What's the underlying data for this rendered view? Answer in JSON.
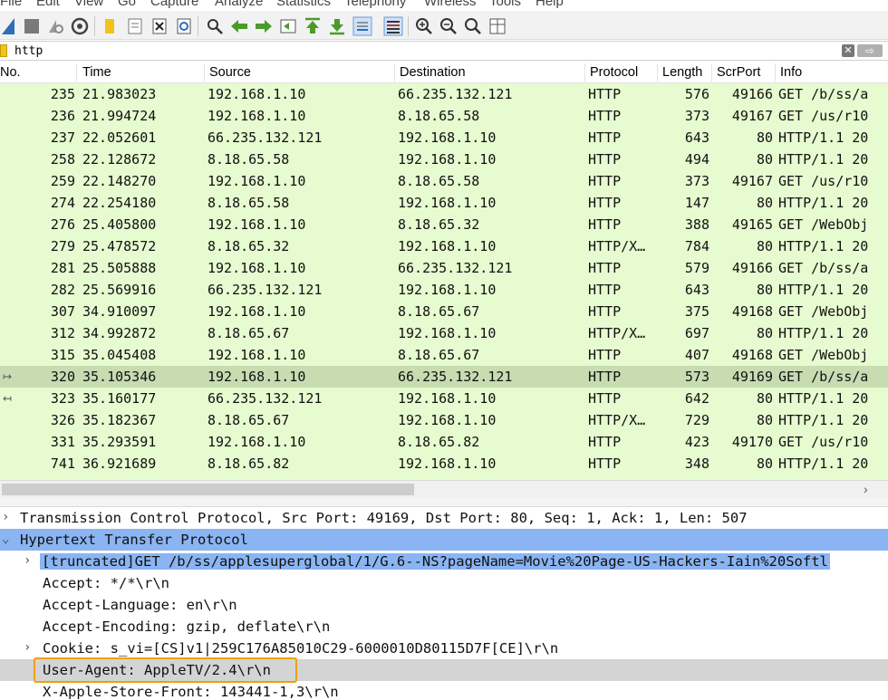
{
  "menu": [
    "File",
    "Edit",
    "View",
    "Go",
    "Capture",
    "Analyze",
    "Statistics",
    "Telephony",
    "Wireless",
    "Tools",
    "Help"
  ],
  "filter": {
    "value": "http"
  },
  "columns": [
    "No.",
    "Time",
    "Source",
    "Destination",
    "Protocol",
    "Length",
    "ScrPort",
    "Info"
  ],
  "packets": [
    {
      "no": "235",
      "time": "21.983023",
      "src": "192.168.1.10",
      "dst": "66.235.132.121",
      "proto": "HTTP",
      "len": "576",
      "port": "49166",
      "info": "GET /b/ss/a"
    },
    {
      "no": "236",
      "time": "21.994724",
      "src": "192.168.1.10",
      "dst": "8.18.65.58",
      "proto": "HTTP",
      "len": "373",
      "port": "49167",
      "info": "GET /us/r10"
    },
    {
      "no": "237",
      "time": "22.052601",
      "src": "66.235.132.121",
      "dst": "192.168.1.10",
      "proto": "HTTP",
      "len": "643",
      "port": "80",
      "info": "HTTP/1.1 20"
    },
    {
      "no": "258",
      "time": "22.128672",
      "src": "8.18.65.58",
      "dst": "192.168.1.10",
      "proto": "HTTP",
      "len": "494",
      "port": "80",
      "info": "HTTP/1.1 20"
    },
    {
      "no": "259",
      "time": "22.148270",
      "src": "192.168.1.10",
      "dst": "8.18.65.58",
      "proto": "HTTP",
      "len": "373",
      "port": "49167",
      "info": "GET /us/r10"
    },
    {
      "no": "274",
      "time": "22.254180",
      "src": "8.18.65.58",
      "dst": "192.168.1.10",
      "proto": "HTTP",
      "len": "147",
      "port": "80",
      "info": "HTTP/1.1 20"
    },
    {
      "no": "276",
      "time": "25.405800",
      "src": "192.168.1.10",
      "dst": "8.18.65.32",
      "proto": "HTTP",
      "len": "388",
      "port": "49165",
      "info": "GET /WebObj"
    },
    {
      "no": "279",
      "time": "25.478572",
      "src": "8.18.65.32",
      "dst": "192.168.1.10",
      "proto": "HTTP/X…",
      "len": "784",
      "port": "80",
      "info": "HTTP/1.1 20"
    },
    {
      "no": "281",
      "time": "25.505888",
      "src": "192.168.1.10",
      "dst": "66.235.132.121",
      "proto": "HTTP",
      "len": "579",
      "port": "49166",
      "info": "GET /b/ss/a"
    },
    {
      "no": "282",
      "time": "25.569916",
      "src": "66.235.132.121",
      "dst": "192.168.1.10",
      "proto": "HTTP",
      "len": "643",
      "port": "80",
      "info": "HTTP/1.1 20"
    },
    {
      "no": "307",
      "time": "34.910097",
      "src": "192.168.1.10",
      "dst": "8.18.65.67",
      "proto": "HTTP",
      "len": "375",
      "port": "49168",
      "info": "GET /WebObj"
    },
    {
      "no": "312",
      "time": "34.992872",
      "src": "8.18.65.67",
      "dst": "192.168.1.10",
      "proto": "HTTP/X…",
      "len": "697",
      "port": "80",
      "info": "HTTP/1.1 20"
    },
    {
      "no": "315",
      "time": "35.045408",
      "src": "192.168.1.10",
      "dst": "8.18.65.67",
      "proto": "HTTP",
      "len": "407",
      "port": "49168",
      "info": "GET /WebObj"
    },
    {
      "no": "320",
      "time": "35.105346",
      "src": "192.168.1.10",
      "dst": "66.235.132.121",
      "proto": "HTTP",
      "len": "573",
      "port": "49169",
      "info": "GET /b/ss/a",
      "selected": true
    },
    {
      "no": "323",
      "time": "35.160177",
      "src": "66.235.132.121",
      "dst": "192.168.1.10",
      "proto": "HTTP",
      "len": "642",
      "port": "80",
      "info": "HTTP/1.1 20"
    },
    {
      "no": "326",
      "time": "35.182367",
      "src": "8.18.65.67",
      "dst": "192.168.1.10",
      "proto": "HTTP/X…",
      "len": "729",
      "port": "80",
      "info": "HTTP/1.1 20"
    },
    {
      "no": "331",
      "time": "35.293591",
      "src": "192.168.1.10",
      "dst": "8.18.65.82",
      "proto": "HTTP",
      "len": "423",
      "port": "49170",
      "info": "GET /us/r10"
    },
    {
      "no": "741",
      "time": "36.921689",
      "src": "8.18.65.82",
      "dst": "192.168.1.10",
      "proto": "HTTP",
      "len": "348",
      "port": "80",
      "info": "HTTP/1.1 20"
    }
  ],
  "details": [
    {
      "text": "Transmission Control Protocol, Src Port: 49169, Dst Port: 80, Seq: 1, Ack: 1, Len: 507",
      "arrow": "›",
      "state": "normal"
    },
    {
      "text": "Hypertext Transfer Protocol",
      "arrow": "⌄",
      "state": "selected"
    },
    {
      "text": "[truncated]GET /b/ss/applesuperglobal/1/G.6--NS?pageName=Movie%20Page-US-Hackers-Iain%20Softl",
      "arrow": "›",
      "state": "subselected"
    },
    {
      "text": "Accept: */*\\r\\n",
      "arrow": "",
      "state": "normal"
    },
    {
      "text": "Accept-Language: en\\r\\n",
      "arrow": "",
      "state": "normal"
    },
    {
      "text": "Accept-Encoding: gzip, deflate\\r\\n",
      "arrow": "",
      "state": "normal"
    },
    {
      "text": "Cookie: s_vi=[CS]v1|259C176A85010C29-6000010D80115D7F[CE]\\r\\n",
      "arrow": "›",
      "state": "normal"
    },
    {
      "text": "User-Agent: AppleTV/2.4\\r\\n",
      "arrow": "",
      "state": "highlight"
    },
    {
      "text": "X-Apple-Store-Front: 143441-1,3\\r\\n",
      "arrow": "",
      "state": "normal"
    }
  ]
}
